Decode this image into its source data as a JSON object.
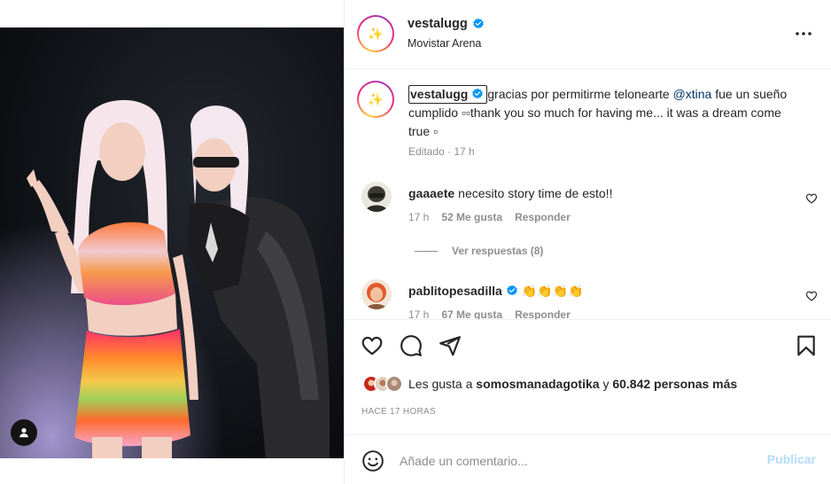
{
  "header": {
    "username": "vestalugg",
    "location": "Movistar Arena"
  },
  "caption": {
    "username": "vestalugg",
    "text_before": "gracias por permitirme telonearte ",
    "mention": "@xtina",
    "text_after": " fue un sueño cumplido ▫▫thank you so much for having me... it was a dream come true ▫",
    "edited": "Editado",
    "time": "17 h"
  },
  "comments": [
    {
      "username": "gaaaete",
      "text": "necesito story time de esto!!",
      "time": "17 h",
      "likes": "52 Me gusta",
      "reply": "Responder",
      "view_replies": "Ver respuestas (8)"
    },
    {
      "username": "pablitopesadilla",
      "text": "👏👏👏👏",
      "time": "17 h",
      "likes": "67 Me gusta",
      "reply": "Responder"
    }
  ],
  "likes": {
    "prefix": "Les gusta a",
    "user": "somosmanadagotika",
    "suffix": "y",
    "count": "60.842 personas más"
  },
  "time_ago": "HACE 17 HORAS",
  "add_comment": {
    "placeholder": "Añade un comentario...",
    "post_label": "Publicar"
  },
  "colors": {
    "verified": "#0095f6",
    "mention": "#00376b",
    "muted": "#8e8e8e",
    "post_disabled": "#b3dbff"
  }
}
